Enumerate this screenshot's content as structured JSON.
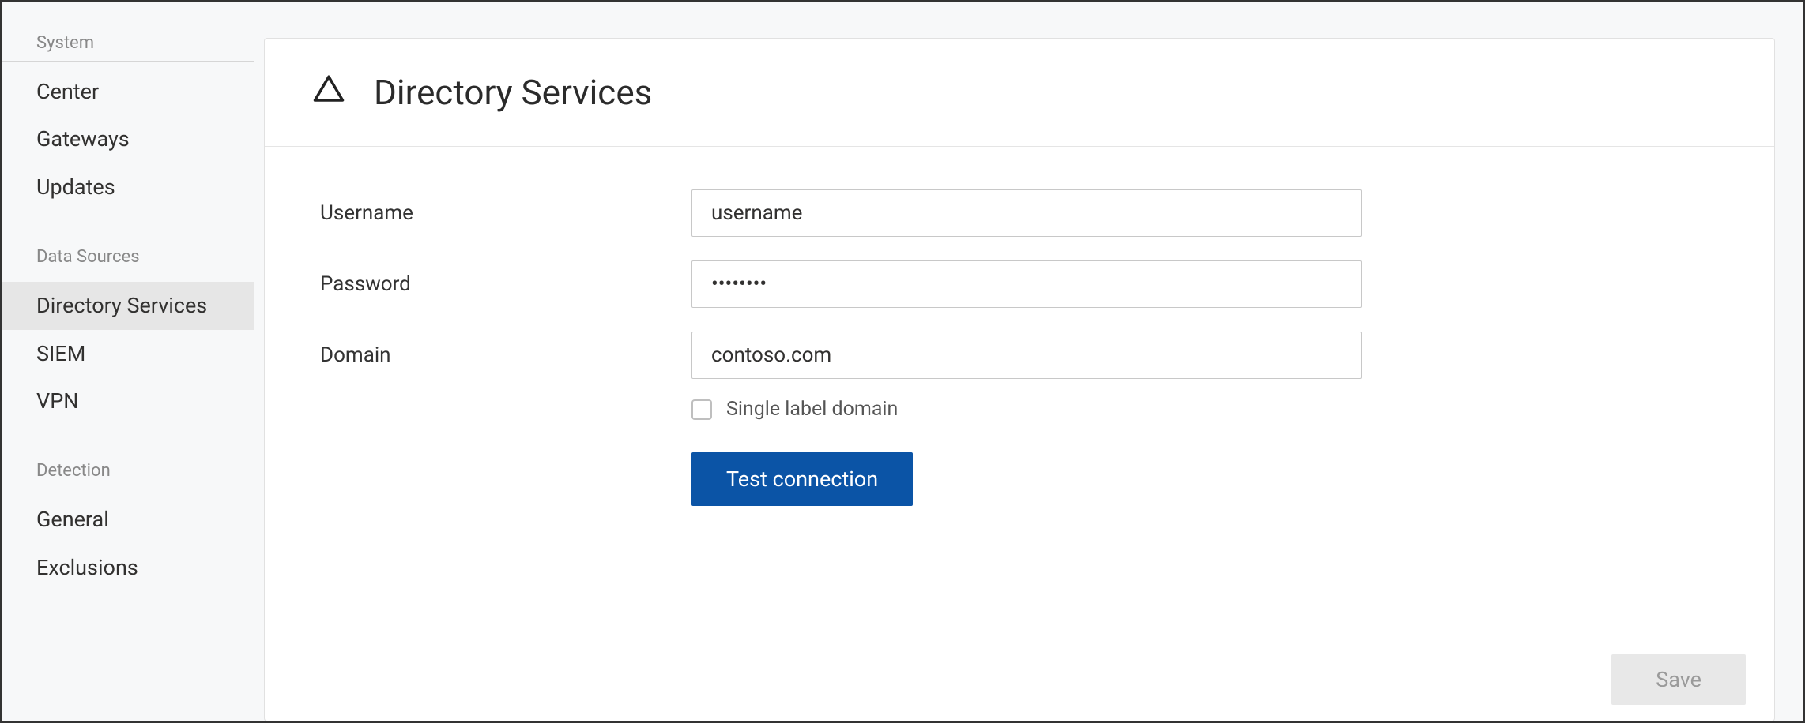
{
  "sidebar": {
    "groups": [
      {
        "header": "System",
        "items": [
          {
            "label": "Center",
            "active": false
          },
          {
            "label": "Gateways",
            "active": false
          },
          {
            "label": "Updates",
            "active": false
          }
        ]
      },
      {
        "header": "Data Sources",
        "items": [
          {
            "label": "Directory Services",
            "active": true
          },
          {
            "label": "SIEM",
            "active": false
          },
          {
            "label": "VPN",
            "active": false
          }
        ]
      },
      {
        "header": "Detection",
        "items": [
          {
            "label": "General",
            "active": false
          },
          {
            "label": "Exclusions",
            "active": false
          }
        ]
      }
    ]
  },
  "panel": {
    "title": "Directory Services",
    "icon_name": "warning-triangle-icon"
  },
  "form": {
    "username": {
      "label": "Username",
      "value": "username"
    },
    "password": {
      "label": "Password",
      "value": "••••••••"
    },
    "domain": {
      "label": "Domain",
      "value": "contoso.com"
    },
    "single_label_domain": {
      "label": "Single label domain",
      "checked": false
    },
    "test_button": "Test connection",
    "save_button": "Save"
  }
}
